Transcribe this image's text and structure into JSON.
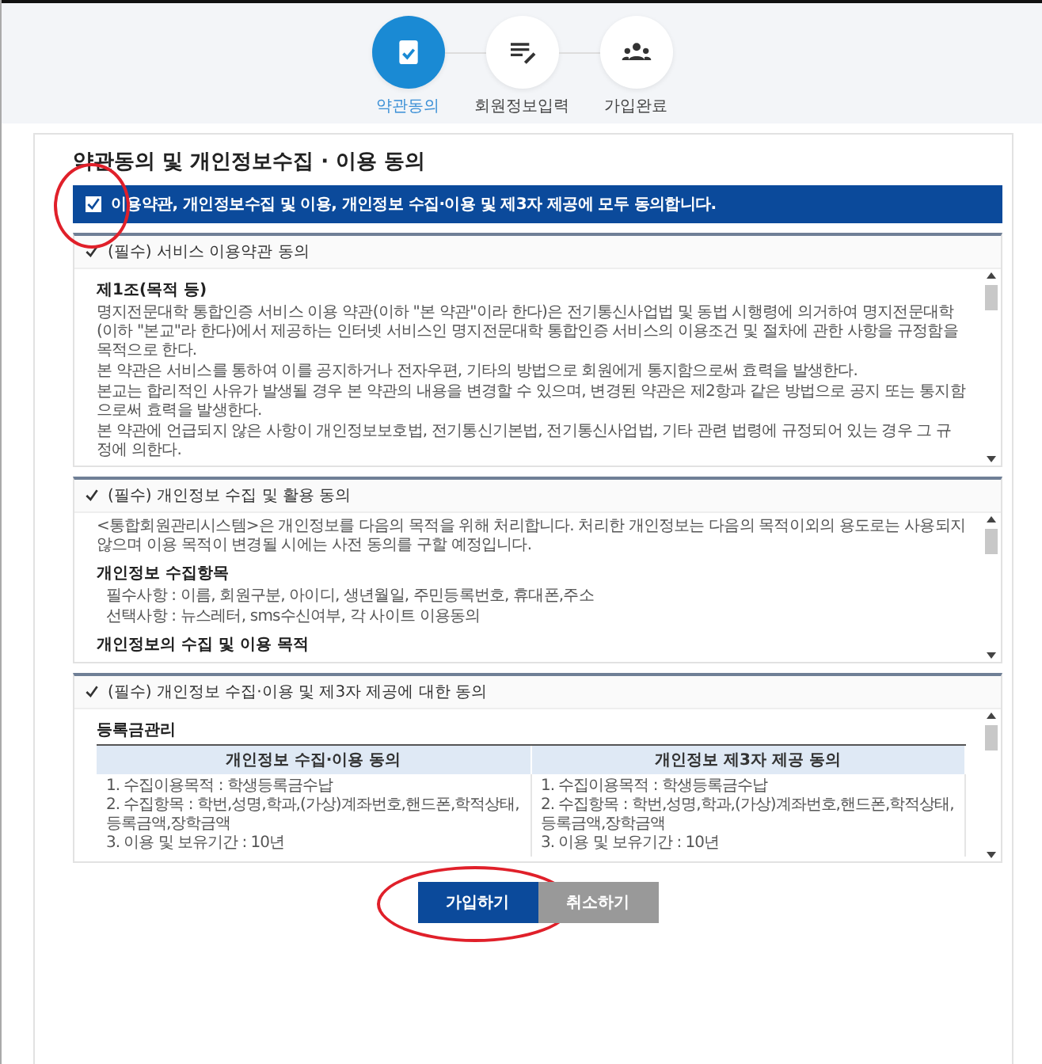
{
  "steps": [
    {
      "label": "약관동의",
      "selected": true
    },
    {
      "label": "회원정보입력",
      "selected": false
    },
    {
      "label": "가입완료",
      "selected": false
    }
  ],
  "title": "약관동의 및 개인정보수집 · 이용 동의",
  "agree_all": {
    "label": "이용약관, 개인정보수집 및 이용, 개인정보 수집·이용 및 제3자 제공에 모두 동의합니다.",
    "checked": true,
    "highlighted": true
  },
  "sections": [
    {
      "label": "(필수) 서비스 이용약관 동의",
      "checked": true,
      "blocks": [
        {
          "kind": "heading",
          "text": "제1조(목적 등)"
        },
        {
          "kind": "paragraph",
          "text": "명지전문대학 통합인증 서비스 이용 약관(이하 \"본 약관\"이라 한다)은 전기통신사업법 및 동법 시행령에 의거하여 명지전문대학(이하 \"본교\"라 한다)에서 제공하는 인터넷 서비스인 명지전문대학 통합인증 서비스의 이용조건 및 절차에 관한 사항을 규정함을 목적으로 한다."
        },
        {
          "kind": "paragraph",
          "text": "본 약관은 서비스를 통하여 이를 공지하거나 전자우편, 기타의 방법으로 회원에게 통지함으로써 효력을 발생한다."
        },
        {
          "kind": "paragraph",
          "text": "본교는 합리적인 사유가 발생될 경우 본 약관의 내용을 변경할 수 있으며, 변경된 약관은 제2항과 같은 방법으로 공지 또는 통지함으로써 효력을 발생한다."
        },
        {
          "kind": "paragraph",
          "text": "본 약관에 언급되지 않은 사항이 개인정보보호법, 전기통신기본법, 전기통신사업법, 기타 관련 법령에 규정되어 있는 경우 그 규정에 의한다."
        }
      ]
    },
    {
      "label": "(필수) 개인정보 수집 및 활용 동의",
      "checked": true,
      "blocks": [
        {
          "kind": "paragraph",
          "text": "<통합회원관리시스템>은 개인정보를 다음의 목적을 위해 처리합니다. 처리한 개인정보는 다음의 목적이외의 용도로는 사용되지 않으며 이용 목적이 변경될 시에는 사전 동의를 구할 예정입니다."
        },
        {
          "kind": "heading",
          "text": "개인정보 수집항목"
        },
        {
          "kind": "item",
          "text": "필수사항 : 이름, 회원구분, 아이디, 생년월일, 주민등록번호, 휴대폰,주소"
        },
        {
          "kind": "item",
          "text": "선택사항 : 뉴스레터, sms수신여부, 각 사이트 이용동의"
        },
        {
          "kind": "heading",
          "text": "개인정보의 수집 및 이용 목적"
        }
      ]
    },
    {
      "label": "(필수) 개인정보 수집·이용 및 제3자 제공에 대한 동의",
      "checked": true,
      "blocks": [
        {
          "kind": "heading",
          "text": "등록금관리"
        },
        {
          "kind": "table",
          "columns": [
            "개인정보 수집·이용 동의",
            "개인정보 제3자 제공 동의"
          ],
          "cells": [
            [
              "1. 수집이용목적 : 학생등록금수납",
              "2. 수집항목 : 학번,성명,학과,(가상)계좌번호,핸드폰,학적상태,등록금액,장학금액",
              "3. 이용 및 보유기간 : 10년"
            ],
            [
              "1. 수집이용목적 : 학생등록금수납",
              "2. 수집항목 : 학번,성명,학과,(가상)계좌번호,핸드폰,학적상태,등록금액,장학금액",
              "3. 이용 및 보유기간 : 10년"
            ]
          ]
        }
      ]
    }
  ],
  "buttons": [
    {
      "label": "가입하기",
      "kind": "primary",
      "highlighted": true
    },
    {
      "label": "취소하기",
      "kind": "secondary",
      "highlighted": false
    }
  ]
}
